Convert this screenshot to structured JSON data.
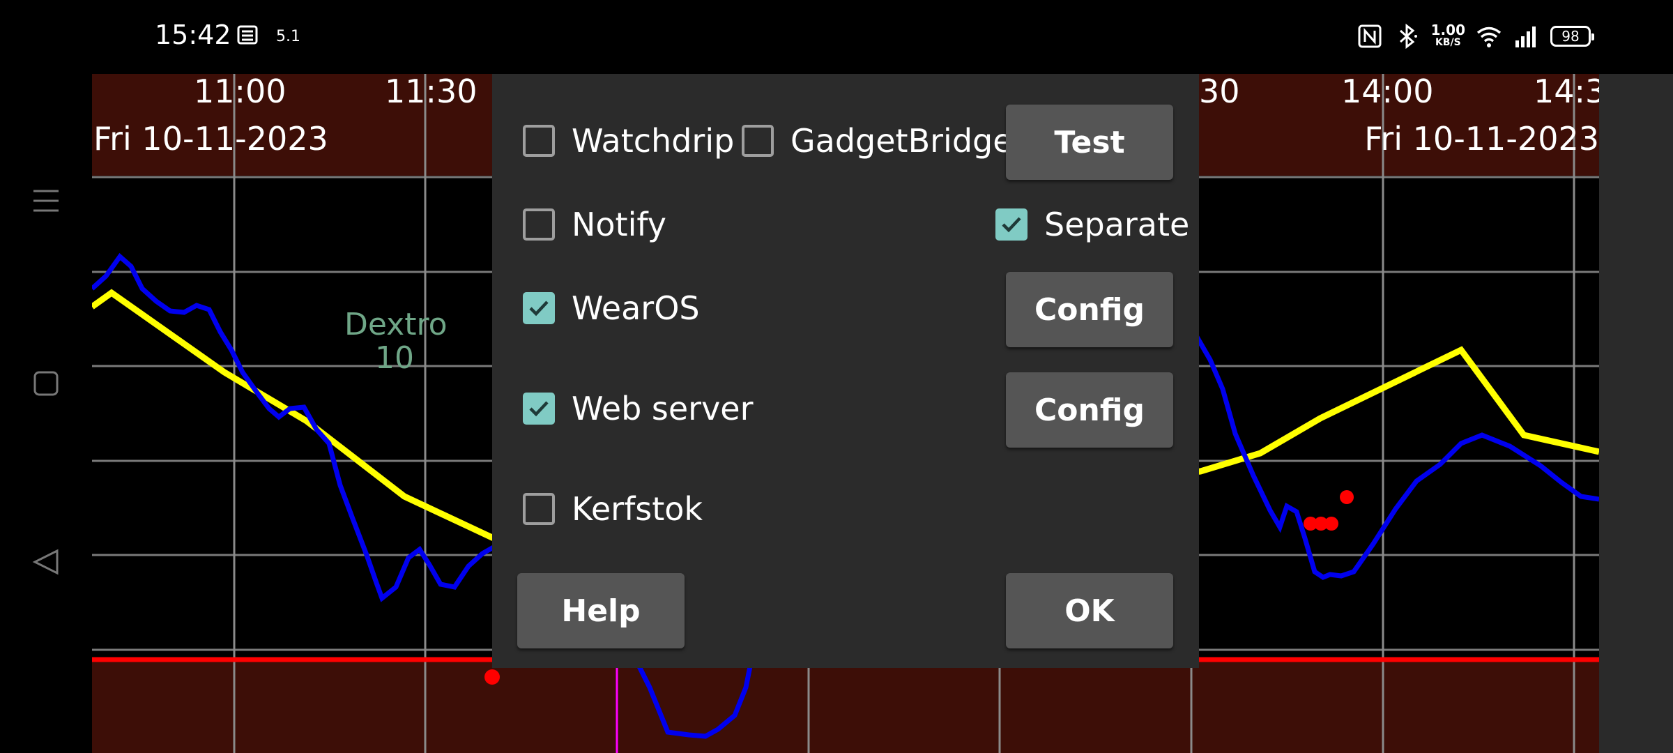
{
  "status_bar": {
    "time": "15:42",
    "small_indicator": "5.1",
    "net_speed_value": "1.00",
    "net_speed_unit": "KB/S",
    "battery": "98",
    "icons": [
      "nfc-icon",
      "bluetooth-icon",
      "wifi-icon",
      "signal-icon",
      "battery-icon"
    ]
  },
  "nav": {
    "icons": [
      "menu-icon",
      "square-icon",
      "back-triangle-icon"
    ]
  },
  "chart": {
    "date_left": "Fri 10-11-2023",
    "date_right": "Fri 10-11-2023",
    "time_labels": [
      "11:00",
      "11:30",
      "30",
      "14:00",
      "14:3"
    ],
    "annotation_line1": "Dextro",
    "annotation_line2": "10",
    "colors": {
      "header_band": "#3d0e07",
      "glucose_line": "#0000ee",
      "trend_line": "#ffff00",
      "low_line": "#ff0000",
      "marker": "#ff0000",
      "annotation": "#6fa687",
      "now_line": "#ff00ff"
    }
  },
  "dialog": {
    "watchdrip_label": "Watchdrip",
    "watchdrip_checked": false,
    "gadgetbridge_label": "GadgetBridge",
    "gadgetbridge_checked": false,
    "test_button": "Test",
    "notify_label": "Notify",
    "notify_checked": false,
    "separate_label": "Separate",
    "separate_checked": true,
    "wearos_label": "WearOS",
    "wearos_checked": true,
    "wearos_config_button": "Config",
    "webserver_label": "Web server",
    "webserver_checked": true,
    "webserver_config_button": "Config",
    "kerfstok_label": "Kerfstok",
    "kerfstok_checked": false,
    "help_button": "Help",
    "ok_button": "OK",
    "accent_color": "#80cbc4"
  }
}
